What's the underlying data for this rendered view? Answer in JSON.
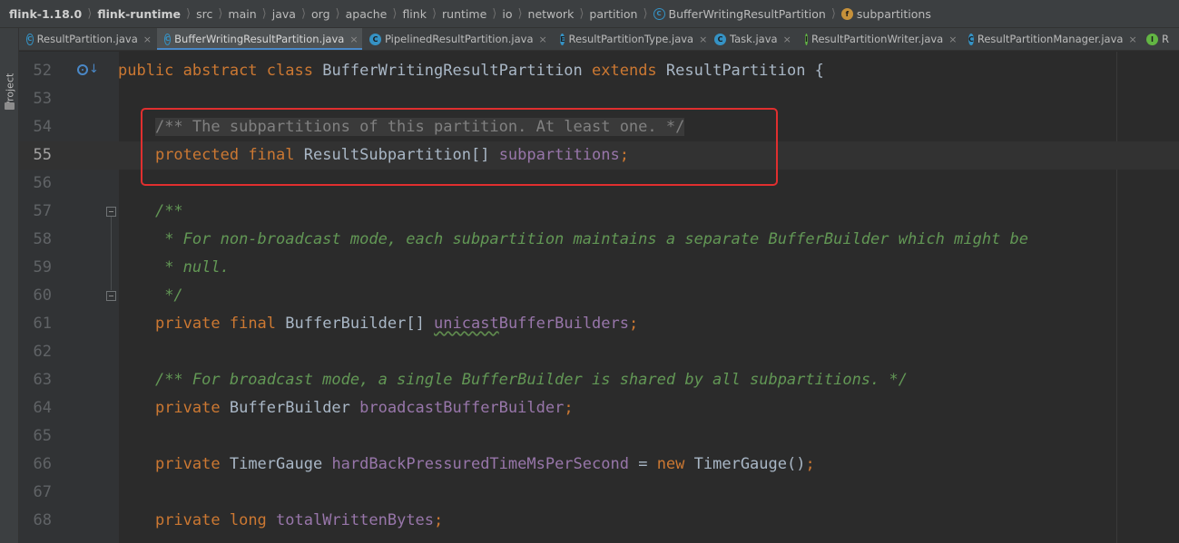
{
  "breadcrumb": {
    "items": [
      "flink-1.18.0",
      "flink-runtime",
      "src",
      "main",
      "java",
      "org",
      "apache",
      "flink",
      "runtime",
      "io",
      "network",
      "partition",
      "BufferWritingResultPartition",
      "subpartitions"
    ],
    "icon_names": [
      "abstract-class-icon",
      "field-icon"
    ]
  },
  "tool_window": {
    "label": "Project",
    "icon": "folder-icon"
  },
  "tabs": [
    {
      "label": "ResultPartition.java",
      "icon": "abstract-class-icon",
      "active": false
    },
    {
      "label": "BufferWritingResultPartition.java",
      "icon": "abstract-class-icon",
      "active": true
    },
    {
      "label": "PipelinedResultPartition.java",
      "icon": "class-icon",
      "active": false
    },
    {
      "label": "ResultPartitionType.java",
      "icon": "enum-icon",
      "active": false
    },
    {
      "label": "Task.java",
      "icon": "class-icon",
      "active": false
    },
    {
      "label": "ResultPartitionWriter.java",
      "icon": "interface-icon",
      "active": false
    },
    {
      "label": "ResultPartitionManager.java",
      "icon": "class-icon",
      "active": false
    },
    {
      "label": "R",
      "icon": "interface-icon",
      "active": false
    }
  ],
  "editor": {
    "current_line": 55,
    "lines": [
      {
        "n": "52",
        "tokens": [
          [
            "kw",
            "public "
          ],
          [
            "kw",
            "abstract "
          ],
          [
            "kw",
            "class "
          ],
          [
            "cls",
            "BufferWritingResultPartition "
          ],
          [
            "kw",
            "extends "
          ],
          [
            "cls",
            "ResultPartition "
          ],
          [
            "plain",
            "{"
          ]
        ]
      },
      {
        "n": "53",
        "tokens": []
      },
      {
        "n": "54",
        "tokens": [
          [
            "pad",
            "    "
          ],
          [
            "cmt-hl",
            "/** The subpartitions of this partition. At least one. */"
          ]
        ]
      },
      {
        "n": "55",
        "tokens": [
          [
            "pad",
            "    "
          ],
          [
            "kw",
            "protected "
          ],
          [
            "kw",
            "final "
          ],
          [
            "cls",
            "ResultSubpartition"
          ],
          [
            "plain",
            "[] "
          ],
          [
            "fld",
            "subpartitions"
          ],
          [
            "pun",
            ";"
          ]
        ]
      },
      {
        "n": "56",
        "tokens": []
      },
      {
        "n": "57",
        "tokens": [
          [
            "pad",
            "    "
          ],
          [
            "doc",
            "/**"
          ]
        ]
      },
      {
        "n": "58",
        "tokens": [
          [
            "pad",
            "    "
          ],
          [
            "doc",
            " * For non-broadcast mode, each subpartition maintains a separate BufferBuilder which might be"
          ]
        ]
      },
      {
        "n": "59",
        "tokens": [
          [
            "pad",
            "    "
          ],
          [
            "doc",
            " * null."
          ]
        ]
      },
      {
        "n": "60",
        "tokens": [
          [
            "pad",
            "    "
          ],
          [
            "doc",
            " */"
          ]
        ]
      },
      {
        "n": "61",
        "tokens": [
          [
            "pad",
            "    "
          ],
          [
            "kw",
            "private "
          ],
          [
            "kw",
            "final "
          ],
          [
            "cls",
            "BufferBuilder"
          ],
          [
            "plain",
            "[] "
          ],
          [
            "fld-typo",
            "unicast"
          ],
          [
            "fld",
            "BufferBuilders"
          ],
          [
            "pun",
            ";"
          ]
        ]
      },
      {
        "n": "62",
        "tokens": []
      },
      {
        "n": "63",
        "tokens": [
          [
            "pad",
            "    "
          ],
          [
            "doc",
            "/** For broadcast mode, a single BufferBuilder is shared by all subpartitions. */"
          ]
        ]
      },
      {
        "n": "64",
        "tokens": [
          [
            "pad",
            "    "
          ],
          [
            "kw",
            "private "
          ],
          [
            "cls",
            "BufferBuilder "
          ],
          [
            "fld",
            "broadcastBufferBuilder"
          ],
          [
            "pun",
            ";"
          ]
        ]
      },
      {
        "n": "65",
        "tokens": []
      },
      {
        "n": "66",
        "tokens": [
          [
            "pad",
            "    "
          ],
          [
            "kw",
            "private "
          ],
          [
            "cls",
            "TimerGauge "
          ],
          [
            "fld",
            "hardBackPressuredTimeMsPerSecond "
          ],
          [
            "plain",
            "= "
          ],
          [
            "kw",
            "new "
          ],
          [
            "cls",
            "TimerGauge"
          ],
          [
            "plain",
            "()"
          ],
          [
            "pun",
            ";"
          ]
        ]
      },
      {
        "n": "67",
        "tokens": []
      },
      {
        "n": "68",
        "tokens": [
          [
            "pad",
            "    "
          ],
          [
            "kw",
            "private "
          ],
          [
            "kw",
            "long "
          ],
          [
            "fld",
            "totalWrittenBytes"
          ],
          [
            "pun",
            ";"
          ]
        ]
      }
    ]
  },
  "annotation": {
    "color": "#e02f2f",
    "highlighted_lines": [
      "54",
      "55"
    ]
  },
  "colors": {
    "keyword": "#cc7832",
    "field": "#9876aa",
    "doc_comment": "#629755",
    "comment": "#808080",
    "text": "#a9b7c6",
    "active_tab_underline": "#4a88c7"
  }
}
